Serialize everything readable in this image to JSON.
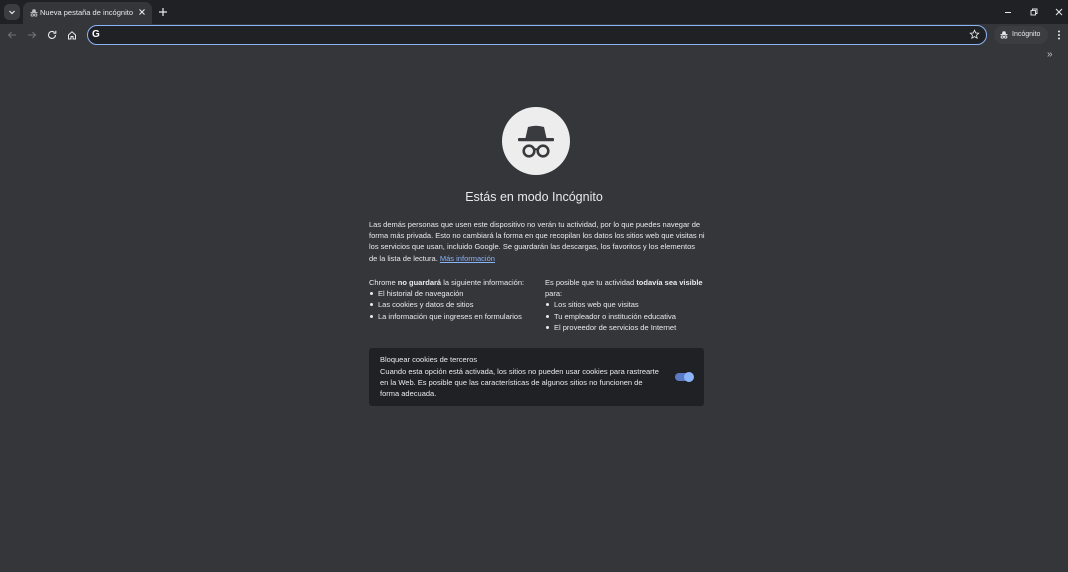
{
  "window": {
    "tab_title": "Nueva pestaña de incógnito"
  },
  "toolbar": {
    "omnibox_value": "",
    "incognito_label": "Incógnito"
  },
  "page": {
    "headline": "Estás en modo Incógnito",
    "intro": "Las demás personas que usen este dispositivo no verán tu actividad, por lo que puedes navegar de forma más privada. Esto no cambiará la forma en que recopilan los datos los sitios web que visitas ni los servicios que usan, incluido Google. Se guardarán las descargas, los favoritos y los elementos de la lista de lectura.",
    "learn_more": "Más información",
    "left_column": {
      "heading_prefix": "Chrome ",
      "heading_bold": "no guardará",
      "heading_suffix": " la siguiente información:",
      "items": [
        "El historial de navegación",
        "Las cookies y datos de sitios",
        "La información que ingreses en formularios"
      ]
    },
    "right_column": {
      "heading_prefix": "Es posible que tu actividad ",
      "heading_bold": "todavía sea visible",
      "heading_suffix": " para:",
      "items": [
        "Los sitios web que visitas",
        "Tu empleador o institución educativa",
        "El proveedor de servicios de Internet"
      ]
    },
    "cookie_card": {
      "title": "Bloquear cookies de terceros",
      "description": "Cuando esta opción está activada, los sitios no pueden usar cookies para rastrearte en la Web. Es posible que las características de algunos sitios no funcionen de forma adecuada.",
      "toggle_on": true
    }
  },
  "colors": {
    "background": "#35363a",
    "frame": "#202124",
    "accent": "#8ab4f8"
  }
}
